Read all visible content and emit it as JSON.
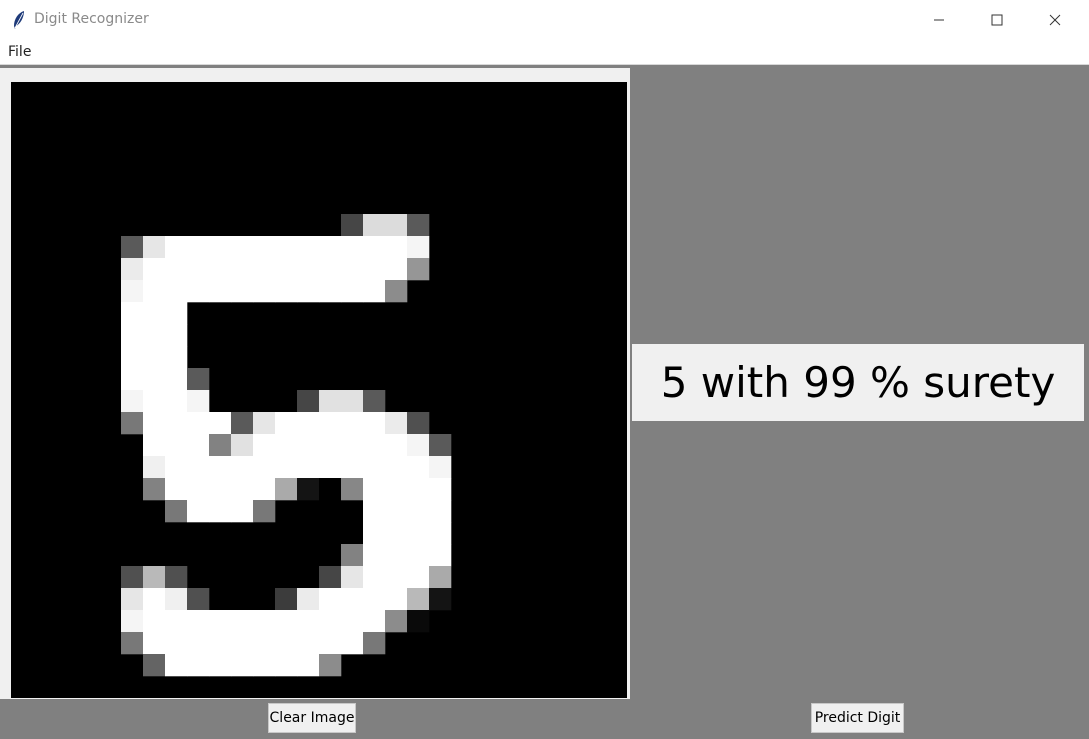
{
  "window": {
    "title": "Digit Recognizer",
    "icon": "feather-icon",
    "controls": [
      "minimize-icon",
      "maximize-icon",
      "close-icon"
    ]
  },
  "menu": {
    "items": [
      "File"
    ]
  },
  "canvas": {
    "grid": 28,
    "background": "#000000",
    "drawn_digit_pixels": [
      [
        6,
        15,
        70
      ],
      [
        6,
        16,
        220
      ],
      [
        6,
        17,
        220
      ],
      [
        6,
        18,
        90
      ],
      [
        7,
        5,
        90
      ],
      [
        7,
        6,
        230
      ],
      [
        7,
        7,
        255
      ],
      [
        7,
        8,
        255
      ],
      [
        7,
        9,
        255
      ],
      [
        7,
        10,
        255
      ],
      [
        7,
        11,
        255
      ],
      [
        7,
        12,
        255
      ],
      [
        7,
        13,
        255
      ],
      [
        7,
        14,
        255
      ],
      [
        7,
        15,
        255
      ],
      [
        7,
        16,
        255
      ],
      [
        7,
        17,
        255
      ],
      [
        7,
        18,
        245
      ],
      [
        8,
        5,
        235
      ],
      [
        8,
        6,
        255
      ],
      [
        8,
        7,
        255
      ],
      [
        8,
        8,
        255
      ],
      [
        8,
        9,
        255
      ],
      [
        8,
        10,
        255
      ],
      [
        8,
        11,
        255
      ],
      [
        8,
        12,
        255
      ],
      [
        8,
        13,
        255
      ],
      [
        8,
        14,
        255
      ],
      [
        8,
        15,
        255
      ],
      [
        8,
        16,
        255
      ],
      [
        8,
        17,
        255
      ],
      [
        8,
        18,
        150
      ],
      [
        9,
        5,
        245
      ],
      [
        9,
        6,
        255
      ],
      [
        9,
        7,
        255
      ],
      [
        9,
        8,
        255
      ],
      [
        9,
        9,
        255
      ],
      [
        9,
        10,
        255
      ],
      [
        9,
        11,
        255
      ],
      [
        9,
        12,
        255
      ],
      [
        9,
        13,
        255
      ],
      [
        9,
        14,
        255
      ],
      [
        9,
        15,
        255
      ],
      [
        9,
        16,
        255
      ],
      [
        9,
        17,
        140
      ],
      [
        10,
        5,
        255
      ],
      [
        10,
        6,
        255
      ],
      [
        10,
        7,
        255
      ],
      [
        11,
        5,
        255
      ],
      [
        11,
        6,
        255
      ],
      [
        11,
        7,
        255
      ],
      [
        12,
        5,
        255
      ],
      [
        12,
        6,
        255
      ],
      [
        12,
        7,
        255
      ],
      [
        13,
        5,
        255
      ],
      [
        13,
        6,
        255
      ],
      [
        13,
        7,
        255
      ],
      [
        13,
        8,
        90
      ],
      [
        14,
        5,
        245
      ],
      [
        14,
        6,
        255
      ],
      [
        14,
        7,
        255
      ],
      [
        14,
        8,
        245
      ],
      [
        14,
        13,
        70
      ],
      [
        14,
        14,
        225
      ],
      [
        14,
        15,
        225
      ],
      [
        14,
        16,
        90
      ],
      [
        15,
        5,
        120
      ],
      [
        15,
        6,
        255
      ],
      [
        15,
        7,
        255
      ],
      [
        15,
        8,
        255
      ],
      [
        15,
        9,
        255
      ],
      [
        15,
        10,
        90
      ],
      [
        15,
        11,
        230
      ],
      [
        15,
        12,
        255
      ],
      [
        15,
        13,
        255
      ],
      [
        15,
        14,
        255
      ],
      [
        15,
        15,
        255
      ],
      [
        15,
        16,
        255
      ],
      [
        15,
        17,
        235
      ],
      [
        15,
        18,
        80
      ],
      [
        16,
        6,
        255
      ],
      [
        16,
        7,
        255
      ],
      [
        16,
        8,
        255
      ],
      [
        16,
        9,
        130
      ],
      [
        16,
        10,
        225
      ],
      [
        16,
        11,
        255
      ],
      [
        16,
        12,
        255
      ],
      [
        16,
        13,
        255
      ],
      [
        16,
        14,
        255
      ],
      [
        16,
        15,
        255
      ],
      [
        16,
        16,
        255
      ],
      [
        16,
        17,
        255
      ],
      [
        16,
        18,
        245
      ],
      [
        16,
        19,
        90
      ],
      [
        17,
        6,
        240
      ],
      [
        17,
        7,
        255
      ],
      [
        17,
        8,
        255
      ],
      [
        17,
        9,
        255
      ],
      [
        17,
        10,
        255
      ],
      [
        17,
        11,
        255
      ],
      [
        17,
        12,
        255
      ],
      [
        17,
        13,
        255
      ],
      [
        17,
        14,
        255
      ],
      [
        17,
        15,
        255
      ],
      [
        17,
        16,
        255
      ],
      [
        17,
        17,
        255
      ],
      [
        17,
        18,
        255
      ],
      [
        17,
        19,
        245
      ],
      [
        18,
        6,
        130
      ],
      [
        18,
        7,
        255
      ],
      [
        18,
        8,
        255
      ],
      [
        18,
        9,
        255
      ],
      [
        18,
        10,
        255
      ],
      [
        18,
        11,
        255
      ],
      [
        18,
        12,
        170
      ],
      [
        18,
        13,
        20
      ],
      [
        18,
        14,
        0
      ],
      [
        18,
        15,
        135
      ],
      [
        18,
        16,
        255
      ],
      [
        18,
        17,
        255
      ],
      [
        18,
        18,
        255
      ],
      [
        18,
        19,
        255
      ],
      [
        19,
        7,
        120
      ],
      [
        19,
        8,
        255
      ],
      [
        19,
        9,
        255
      ],
      [
        19,
        10,
        255
      ],
      [
        19,
        11,
        120
      ],
      [
        19,
        16,
        255
      ],
      [
        19,
        17,
        255
      ],
      [
        19,
        18,
        255
      ],
      [
        19,
        19,
        255
      ],
      [
        20,
        16,
        255
      ],
      [
        20,
        17,
        255
      ],
      [
        20,
        18,
        255
      ],
      [
        20,
        19,
        255
      ],
      [
        21,
        15,
        130
      ],
      [
        21,
        16,
        255
      ],
      [
        21,
        17,
        255
      ],
      [
        21,
        18,
        255
      ],
      [
        21,
        19,
        255
      ],
      [
        22,
        5,
        80
      ],
      [
        22,
        6,
        185
      ],
      [
        22,
        7,
        80
      ],
      [
        22,
        14,
        70
      ],
      [
        22,
        15,
        230
      ],
      [
        22,
        16,
        255
      ],
      [
        22,
        17,
        255
      ],
      [
        22,
        18,
        255
      ],
      [
        22,
        19,
        170
      ],
      [
        23,
        5,
        230
      ],
      [
        23,
        6,
        255
      ],
      [
        23,
        7,
        240
      ],
      [
        23,
        8,
        80
      ],
      [
        23,
        12,
        60
      ],
      [
        23,
        13,
        235
      ],
      [
        23,
        14,
        255
      ],
      [
        23,
        15,
        255
      ],
      [
        23,
        16,
        255
      ],
      [
        23,
        17,
        255
      ],
      [
        23,
        18,
        185
      ],
      [
        23,
        19,
        20
      ],
      [
        24,
        5,
        245
      ],
      [
        24,
        6,
        255
      ],
      [
        24,
        7,
        255
      ],
      [
        24,
        8,
        255
      ],
      [
        24,
        9,
        255
      ],
      [
        24,
        10,
        255
      ],
      [
        24,
        11,
        255
      ],
      [
        24,
        12,
        255
      ],
      [
        24,
        13,
        255
      ],
      [
        24,
        14,
        255
      ],
      [
        24,
        15,
        255
      ],
      [
        24,
        16,
        255
      ],
      [
        24,
        17,
        140
      ],
      [
        24,
        18,
        10
      ],
      [
        25,
        5,
        120
      ],
      [
        25,
        6,
        255
      ],
      [
        25,
        7,
        255
      ],
      [
        25,
        8,
        255
      ],
      [
        25,
        9,
        255
      ],
      [
        25,
        10,
        255
      ],
      [
        25,
        11,
        255
      ],
      [
        25,
        12,
        255
      ],
      [
        25,
        13,
        255
      ],
      [
        25,
        14,
        255
      ],
      [
        25,
        15,
        255
      ],
      [
        25,
        16,
        120
      ],
      [
        26,
        6,
        100
      ],
      [
        26,
        7,
        255
      ],
      [
        26,
        8,
        255
      ],
      [
        26,
        9,
        255
      ],
      [
        26,
        10,
        255
      ],
      [
        26,
        11,
        255
      ],
      [
        26,
        12,
        255
      ],
      [
        26,
        13,
        255
      ],
      [
        26,
        14,
        140
      ]
    ]
  },
  "result": {
    "text": "5 with 99 % surety"
  },
  "buttons": {
    "clear_label": "Clear Image",
    "predict_label": "Predict Digit"
  }
}
